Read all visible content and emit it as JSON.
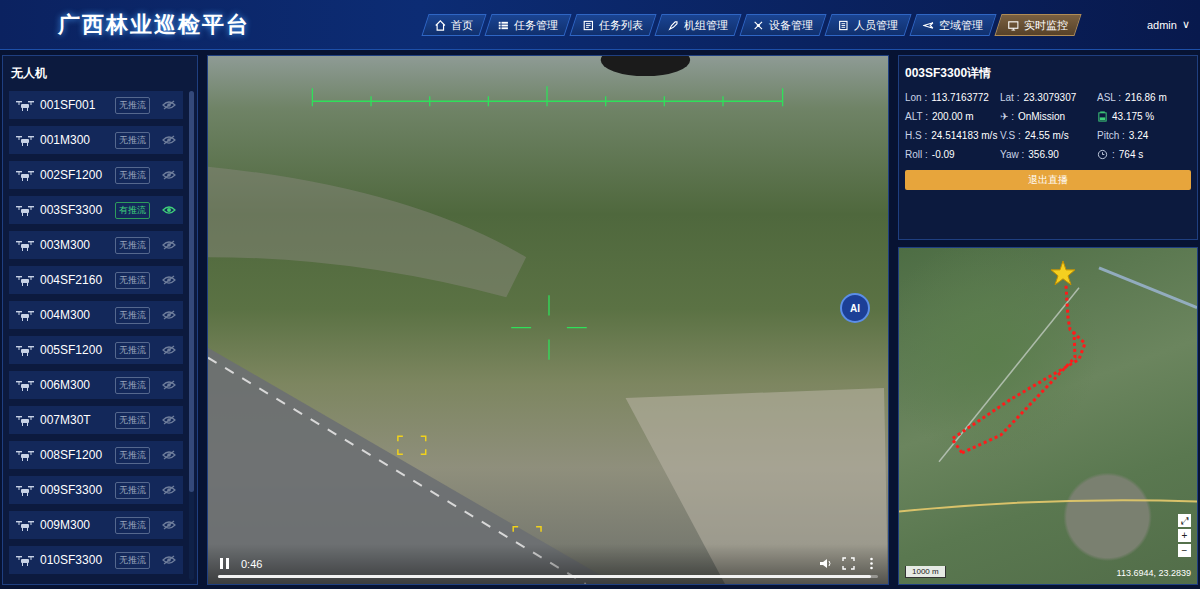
{
  "app": {
    "title": "广西林业巡检平台"
  },
  "nav": [
    {
      "label": "首页",
      "selected": false
    },
    {
      "label": "任务管理",
      "selected": false
    },
    {
      "label": "任务列表",
      "selected": false
    },
    {
      "label": "机组管理",
      "selected": false
    },
    {
      "label": "设备管理",
      "selected": false
    },
    {
      "label": "人员管理",
      "selected": false
    },
    {
      "label": "空域管理",
      "selected": false
    },
    {
      "label": "实时监控",
      "selected": true
    }
  ],
  "user": {
    "name": "admin",
    "caret": "∨"
  },
  "drones": {
    "title": "无人机",
    "items": [
      {
        "name": "001SF001",
        "stream": "无推流",
        "streaming": false
      },
      {
        "name": "001M300",
        "stream": "无推流",
        "streaming": false
      },
      {
        "name": "002SF1200",
        "stream": "无推流",
        "streaming": false
      },
      {
        "name": "003SF3300",
        "stream": "有推流",
        "streaming": true
      },
      {
        "name": "003M300",
        "stream": "无推流",
        "streaming": false
      },
      {
        "name": "004SF2160",
        "stream": "无推流",
        "streaming": false
      },
      {
        "name": "004M300",
        "stream": "无推流",
        "streaming": false
      },
      {
        "name": "005SF1200",
        "stream": "无推流",
        "streaming": false
      },
      {
        "name": "006M300",
        "stream": "无推流",
        "streaming": false
      },
      {
        "name": "007M30T",
        "stream": "无推流",
        "streaming": false
      },
      {
        "name": "008SF1200",
        "stream": "无推流",
        "streaming": false
      },
      {
        "name": "009SF3300",
        "stream": "无推流",
        "streaming": false
      },
      {
        "name": "009M300",
        "stream": "无推流",
        "streaming": false
      },
      {
        "name": "010SF3300",
        "stream": "无推流",
        "streaming": false
      }
    ]
  },
  "video": {
    "time": "0:46",
    "playing": true,
    "progress": 0.99,
    "ai": "AI"
  },
  "detail": {
    "title": "003SF3300详情",
    "fields": [
      {
        "kind": "text",
        "label": "Lon :",
        "value": "113.7163772"
      },
      {
        "kind": "text",
        "label": "Lat :",
        "value": "23.3079307"
      },
      {
        "kind": "text",
        "label": "ASL :",
        "value": "216.86 m"
      },
      {
        "kind": "text",
        "label": "ALT :",
        "value": "200.00 m"
      },
      {
        "kind": "text",
        "label": "✈ :",
        "value": "OnMission"
      },
      {
        "kind": "battery",
        "label": "",
        "value": "43.175 %",
        "level": 0.43
      },
      {
        "kind": "text",
        "label": "H.S :",
        "value": "24.514183 m/s"
      },
      {
        "kind": "text",
        "label": "V.S :",
        "value": "24.55 m/s"
      },
      {
        "kind": "text",
        "label": "Pitch :",
        "value": "3.24"
      },
      {
        "kind": "text",
        "label": "Roll :",
        "value": "-0.09"
      },
      {
        "kind": "text",
        "label": "Yaw :",
        "value": "356.90"
      },
      {
        "kind": "timer",
        "label": ":",
        "value": "764 s"
      }
    ],
    "button": "退出直播"
  },
  "map": {
    "scale": "1000 m",
    "coords": "113.6944, 23.2839",
    "zoom_in": "+",
    "zoom_out": "−",
    "fullscreen": "⤢"
  }
}
